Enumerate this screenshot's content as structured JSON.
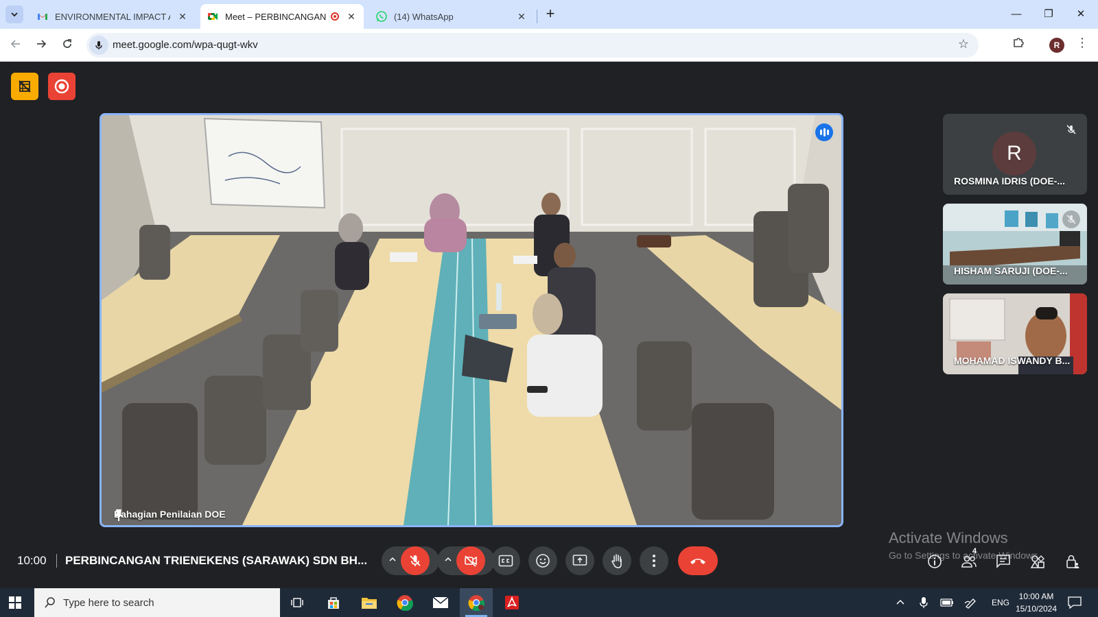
{
  "browser": {
    "tabs": [
      {
        "title": "ENVIRONMENTAL IMPACT ASSI",
        "icon": "gmail-icon",
        "active": false
      },
      {
        "title": "Meet – PERBINCANGAN TR",
        "icon": "meet-icon",
        "active": true,
        "recording": true
      },
      {
        "title": "(14) WhatsApp",
        "icon": "whatsapp-icon",
        "active": false
      }
    ],
    "url": "meet.google.com/wpa-qugt-wkv",
    "profile_initial": "R"
  },
  "meet": {
    "main_tile": {
      "name": "Bahagian Penilaian DOE"
    },
    "participants": [
      {
        "name": "ROSMINA IDRIS (DOE-...",
        "initial": "R",
        "muted": true
      },
      {
        "name": "HISHAM SARUJI (DOE-...",
        "muted": true
      },
      {
        "name": "MOHAMAD ISWANDY B...",
        "muted": false
      }
    ],
    "time": "10:00",
    "meeting_title": "PERBINCANGAN TRIENEKENS (SARAWAK) SDN BH...",
    "participant_count": "4",
    "colors": {
      "accent": "#8ab4f8",
      "danger": "#ea4335",
      "bg": "#202124"
    }
  },
  "watermark": {
    "line1": "Activate Windows",
    "line2": "Go to Settings to activate Windows."
  },
  "taskbar": {
    "search_placeholder": "Type here to search",
    "language": "ENG",
    "time": "10:00 AM",
    "date": "15/10/2024"
  }
}
